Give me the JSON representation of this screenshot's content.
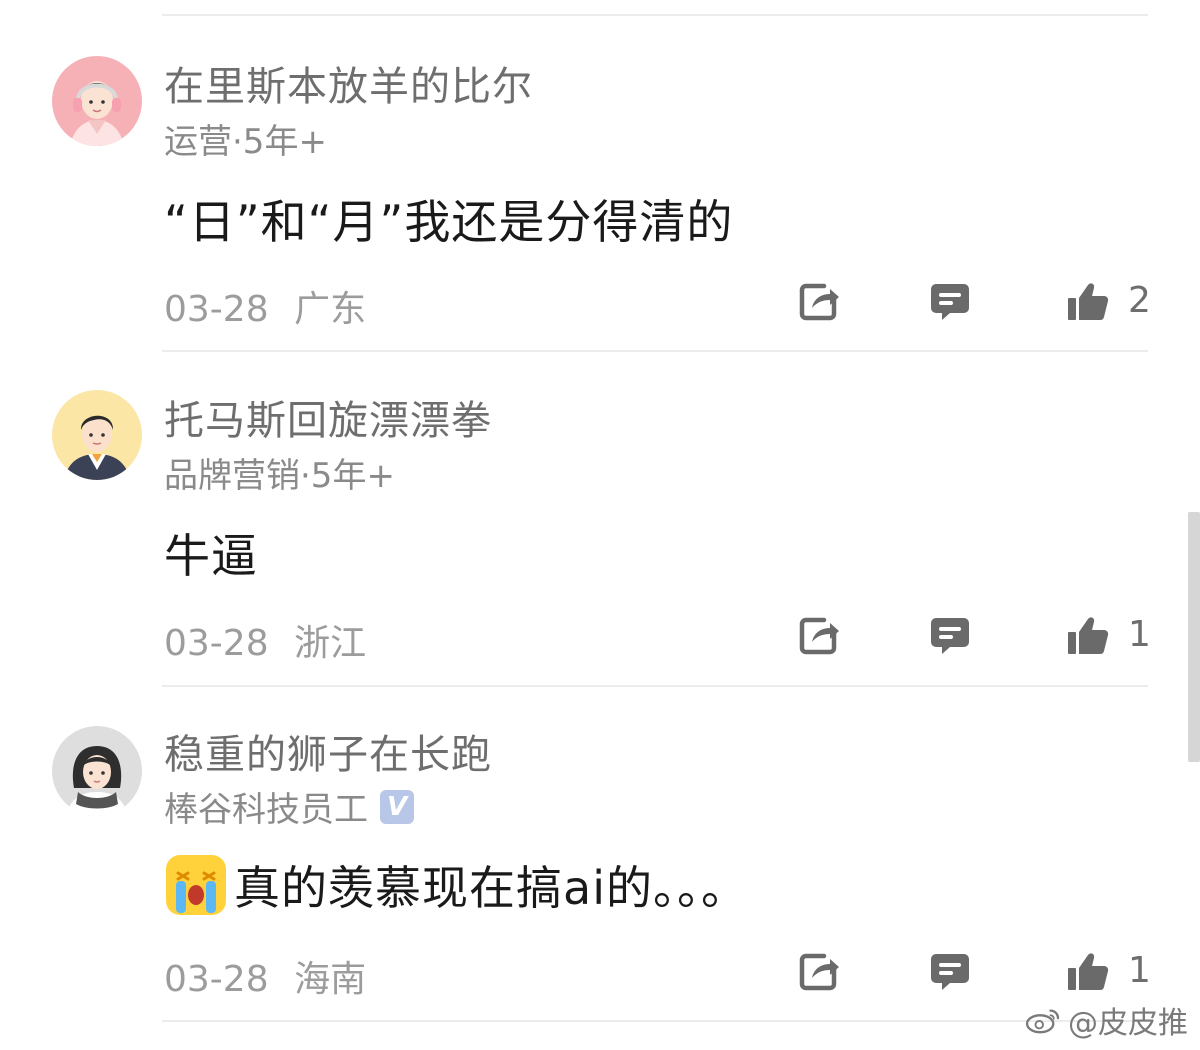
{
  "comments": [
    {
      "username": "在里斯本放羊的比尔",
      "meta": "运营·5年+",
      "body": "“日”和“月”我还是分得清的",
      "date": "03-28",
      "location": "广东",
      "likes": "2",
      "avatar": "avatar-headphones-pink",
      "verified": false
    },
    {
      "username": "托马斯回旋漂漂拳",
      "meta": "品牌营销·5年+",
      "body": "牛逼",
      "date": "03-28",
      "location": "浙江",
      "likes": "1",
      "avatar": "avatar-man-yellow",
      "verified": false
    },
    {
      "username": "稳重的狮子在长跑",
      "meta": "棒谷科技员工",
      "body": "真的羡慕现在搞ai的。。。",
      "date": "03-28",
      "location": "海南",
      "likes": "1",
      "avatar": "avatar-girl-scarf",
      "verified": true,
      "body_emoji": "loudly-crying-emoji"
    }
  ],
  "icons": {
    "share": "share-icon",
    "reply": "reply-icon",
    "like": "thumbs-up-icon"
  },
  "watermark": "@皮皮推",
  "verified_mark": "V",
  "colors": {
    "icon_gray": "#6a6a6a",
    "muted_text": "#9c9c9c",
    "badge": "#b8c7e8"
  }
}
